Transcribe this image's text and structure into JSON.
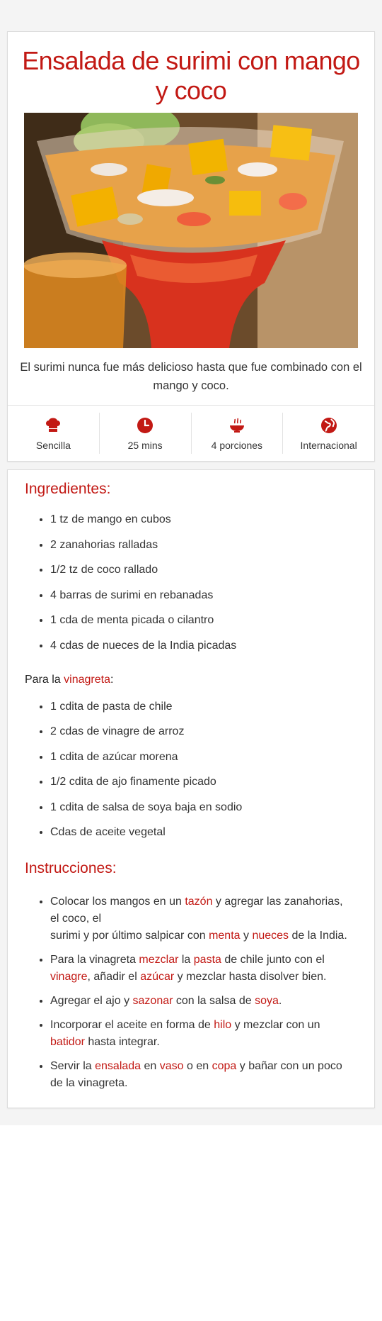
{
  "recipe": {
    "title": "Ensalada de surimi con mango y coco",
    "image_alt": "Ensalada de surimi con mango y coco en copa de cristal",
    "intro": "El surimi nunca fue más delicioso hasta que fue combinado con el mango y coco."
  },
  "meta": [
    {
      "icon": "chef-hat-icon",
      "label": "Sencilla"
    },
    {
      "icon": "clock-icon",
      "label": "25 mins"
    },
    {
      "icon": "bowl-icon",
      "label": "4 porciones"
    },
    {
      "icon": "globe-icon",
      "label": "Internacional"
    }
  ],
  "ingredients": {
    "heading": "Ingredientes:",
    "items": [
      "1 tz de mango en cubos",
      "2 zanahorias ralladas",
      "1/2 tz de coco rallado",
      "4 barras de surimi en rebanadas",
      "1 cda de menta picada o cilantro",
      "4 cdas de nueces de la India picadas"
    ],
    "vinagreta_prefix": "Para la ",
    "vinagreta_link": "vinagreta",
    "vinagreta_suffix": ":",
    "vinagreta_items": [
      "1 cdita de pasta de chile",
      "2 cdas de vinagre de arroz",
      "1 cdita de azúcar morena",
      "1/2 cdita de ajo finamente picado",
      "1 cdita de salsa de soya baja en sodio",
      "Cdas de aceite vegetal"
    ]
  },
  "instructions": {
    "heading": "Instrucciones:",
    "steps": [
      [
        {
          "t": "Colocar los mangos en un "
        },
        {
          "t": "tazón",
          "link": true
        },
        {
          "t": " y agregar las zanahorias, el coco, el"
        },
        {
          "br": true
        },
        {
          "t": "surimi y por último salpicar con "
        },
        {
          "t": "menta",
          "link": true
        },
        {
          "t": " y "
        },
        {
          "t": "nueces",
          "link": true
        },
        {
          "t": " de la India."
        }
      ],
      [
        {
          "t": "Para la vinagreta "
        },
        {
          "t": "mezclar",
          "link": true
        },
        {
          "t": " la "
        },
        {
          "t": "pasta",
          "link": true
        },
        {
          "t": " de chile junto con el "
        },
        {
          "t": "vinagre",
          "link": true
        },
        {
          "t": ", añadir el "
        },
        {
          "t": "azúcar",
          "link": true
        },
        {
          "t": " y mezclar hasta disolver bien."
        }
      ],
      [
        {
          "t": "Agregar el ajo y "
        },
        {
          "t": "sazonar",
          "link": true
        },
        {
          "t": " con la salsa de "
        },
        {
          "t": "soya",
          "link": true
        },
        {
          "t": "."
        }
      ],
      [
        {
          "t": "Incorporar el aceite en forma de "
        },
        {
          "t": "hilo",
          "link": true
        },
        {
          "t": " y mezclar con un "
        },
        {
          "t": "batidor",
          "link": true
        },
        {
          "t": " hasta integrar."
        }
      ],
      [
        {
          "t": "Servir la "
        },
        {
          "t": "ensalada",
          "link": true
        },
        {
          "t": " en "
        },
        {
          "t": "vaso",
          "link": true
        },
        {
          "t": " o en "
        },
        {
          "t": "copa",
          "link": true
        },
        {
          "t": " y bañar con un poco de la vinagreta."
        }
      ]
    ]
  },
  "colors": {
    "accent": "#c21914",
    "text": "#333333",
    "border": "#dcdcdc"
  }
}
